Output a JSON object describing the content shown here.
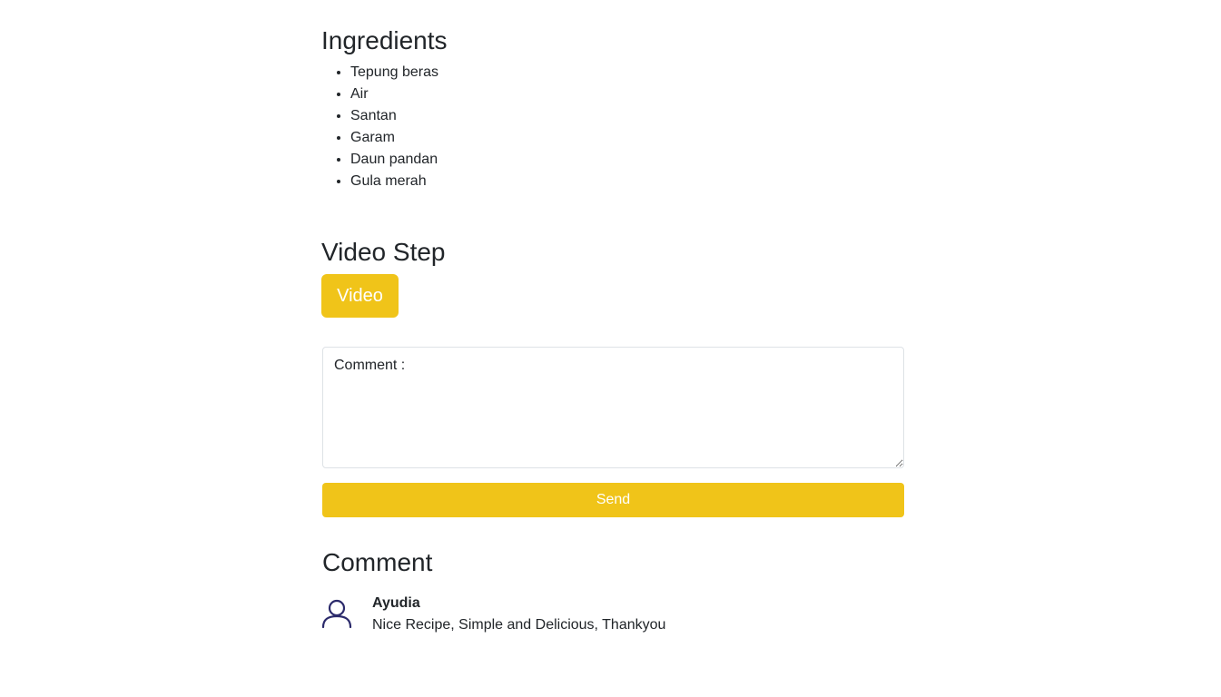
{
  "ingredients": {
    "title": "Ingredients",
    "items": [
      "Tepung beras",
      "Air",
      "Santan",
      "Garam",
      "Daun pandan",
      "Gula merah"
    ]
  },
  "video": {
    "title": "Video Step",
    "button_label": "Video"
  },
  "comment_form": {
    "placeholder": "Comment :",
    "value": "",
    "send_label": "Send"
  },
  "comments": {
    "title": "Comment",
    "items": [
      {
        "author": "Ayudia",
        "text": "Nice Recipe, Simple and Delicious, Thankyou",
        "avatar_icon": "user-icon"
      }
    ]
  },
  "colors": {
    "accent": "#f0c419",
    "avatar_stroke": "#2b2a6b",
    "text": "#212529"
  }
}
